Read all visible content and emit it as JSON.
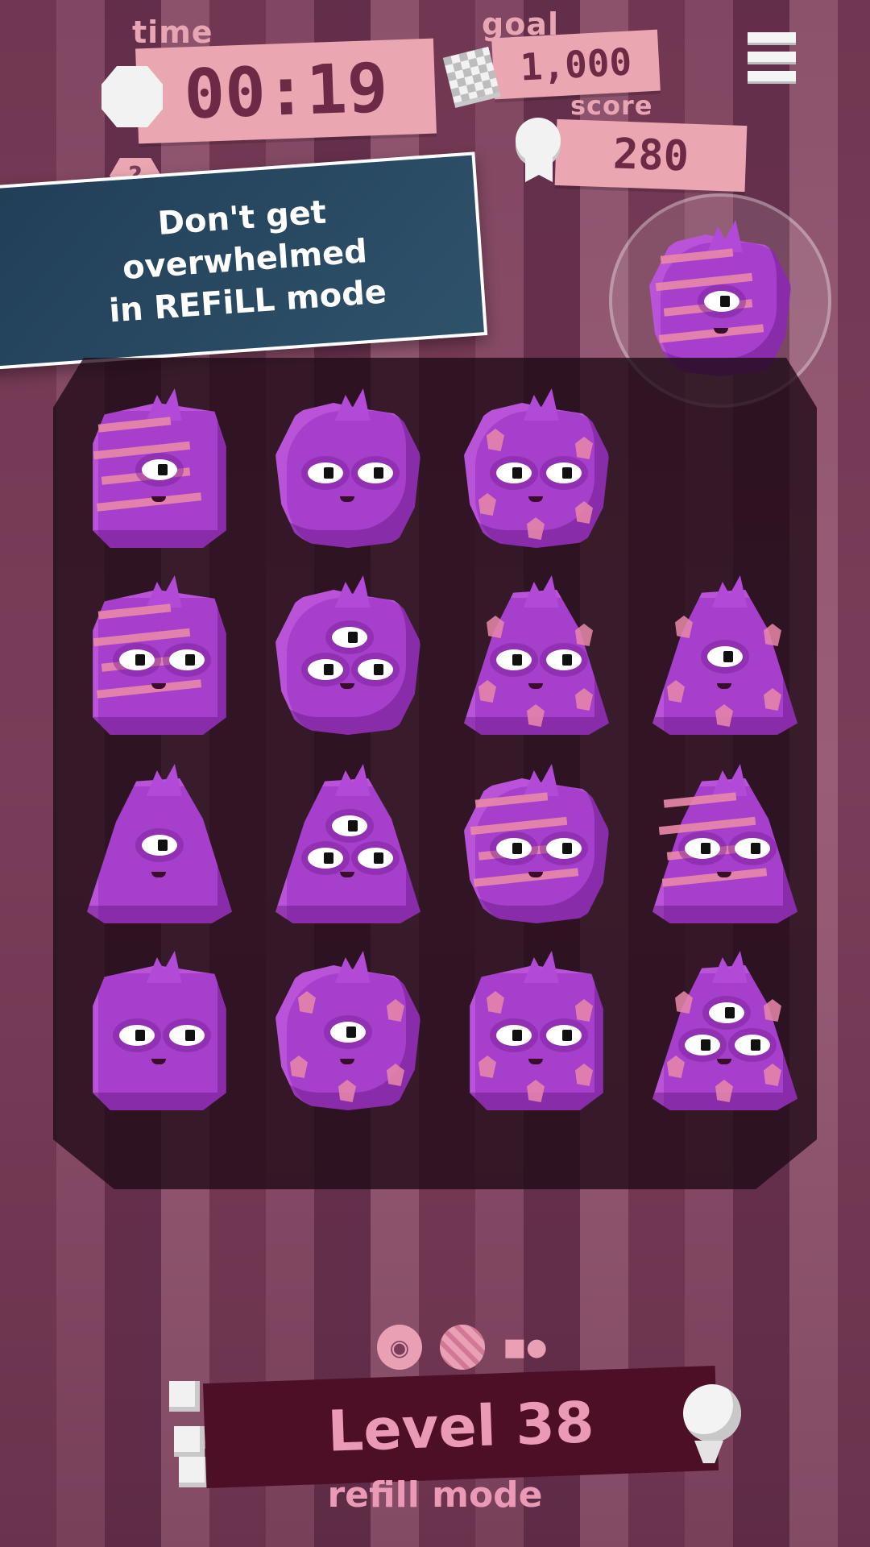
{
  "hud": {
    "time_label": "time",
    "time_value": "00:19",
    "goal_label": "goal",
    "goal_value": "1,000",
    "score_label": "score",
    "score_value": "280",
    "help_label": "?"
  },
  "tip": {
    "text_line1": "Don't get overwhelmed",
    "text_line2": "in REFiLL mode"
  },
  "board": {
    "rows": [
      [
        {
          "shape": "square",
          "eyes": 1,
          "pattern": "stripes"
        },
        {
          "shape": "blob",
          "eyes": 2,
          "pattern": "none"
        },
        {
          "shape": "blob",
          "eyes": 2,
          "pattern": "spots"
        },
        null
      ],
      [
        {
          "shape": "square",
          "eyes": 2,
          "pattern": "stripes"
        },
        {
          "shape": "blob",
          "eyes": 3,
          "pattern": "none"
        },
        {
          "shape": "tri",
          "eyes": 2,
          "pattern": "spots"
        },
        {
          "shape": "tri",
          "eyes": 1,
          "pattern": "spots"
        }
      ],
      [
        {
          "shape": "tri",
          "eyes": 1,
          "pattern": "none"
        },
        {
          "shape": "tri",
          "eyes": 3,
          "pattern": "none"
        },
        {
          "shape": "blob",
          "eyes": 2,
          "pattern": "stripes"
        },
        {
          "shape": "tri",
          "eyes": 2,
          "pattern": "stripes"
        }
      ],
      [
        {
          "shape": "square",
          "eyes": 2,
          "pattern": "none"
        },
        {
          "shape": "blob",
          "eyes": 1,
          "pattern": "spots"
        },
        {
          "shape": "square",
          "eyes": 2,
          "pattern": "spots"
        },
        {
          "shape": "tri",
          "eyes": 3,
          "pattern": "spots"
        }
      ]
    ],
    "held_monster": {
      "shape": "blob",
      "eyes": 1,
      "pattern": "stripes"
    }
  },
  "footer": {
    "level_label": "Level 38",
    "mode_label": "refill mode",
    "mode_icons": [
      "eye-icon",
      "stripes-icon",
      "shapes-icon"
    ]
  },
  "colors": {
    "monster": "#a63fcb",
    "pattern": "#e98aa9",
    "banner_pink": "#eaa7b2",
    "tip_bg": "#213e57",
    "level_bar": "#4c0f26"
  }
}
